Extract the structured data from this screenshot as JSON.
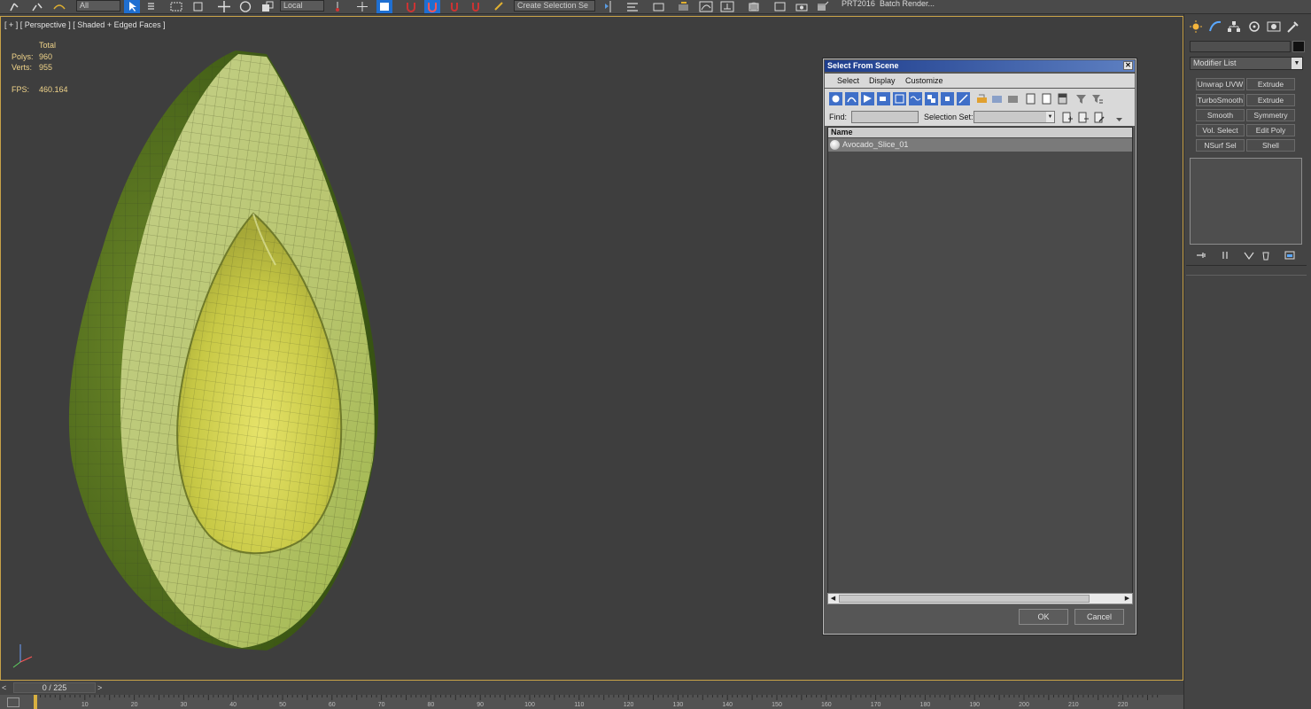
{
  "toolbar": {
    "coord_system": "Local",
    "named_selection_sets": "Create Selection Se",
    "prt_label": "PRT2016",
    "batch_render_label": "Batch Render..."
  },
  "viewport": {
    "label": "[ + ] [ Perspective ] [ Shaded + Edged Faces ]",
    "stats": {
      "header": "Total",
      "polys_label": "Polys:",
      "polys_value": "960",
      "verts_label": "Verts:",
      "verts_value": "955",
      "fps_label": "FPS:",
      "fps_value": "460.164"
    }
  },
  "command_panel": {
    "modifier_list_label": "Modifier List",
    "modifier_buttons": [
      "Unwrap UVW",
      "Extrude",
      "TurboSmooth",
      "Extrude",
      "Smooth",
      "Symmetry",
      "Vol. Select",
      "Edit Poly",
      "NSurf Sel",
      "Shell"
    ]
  },
  "timeline": {
    "frame_display": "0 / 225",
    "prev_symbol": "<",
    "next_symbol": ">",
    "track_ticks": [
      "10",
      "20",
      "30",
      "40",
      "50",
      "60",
      "70",
      "80",
      "90",
      "100",
      "110",
      "120",
      "130",
      "140",
      "150",
      "160",
      "170",
      "180",
      "190",
      "200",
      "210",
      "220"
    ]
  },
  "dialog": {
    "title": "Select From Scene",
    "close_symbol": "✕",
    "menu": [
      "Select",
      "Display",
      "Customize"
    ],
    "find_label": "Find:",
    "find_value": "",
    "selection_set_label": "Selection Set:",
    "column_name": "Name",
    "objects": [
      {
        "name": "Avocado_Slice_01"
      }
    ],
    "ok_label": "OK",
    "cancel_label": "Cancel"
  },
  "colors": {
    "viewport_bg": "#3e3e3e",
    "active_viewport_border": "#c8a248",
    "stats_text": "#f0d48a",
    "dialog_title_bar": "#1e3d8c",
    "toolbar_active": "#1f6fd1"
  }
}
